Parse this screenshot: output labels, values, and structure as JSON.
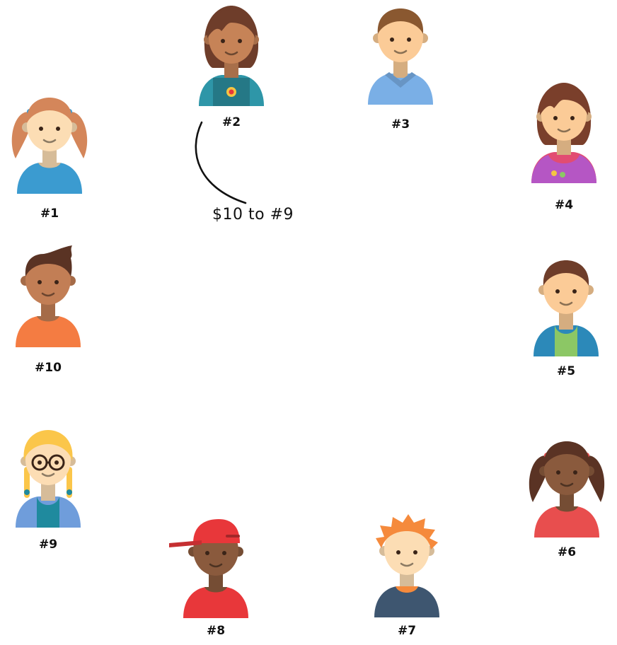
{
  "people": [
    {
      "id": "1",
      "label": "#1",
      "style": "pigtails",
      "skin": "#FCDDB4",
      "hair": "#D4865A",
      "shirt": "#3B9BD0",
      "band": "#3B9BD0"
    },
    {
      "id": "2",
      "label": "#2",
      "style": "bob",
      "skin": "#C68357",
      "hair": "#6E3D2A",
      "shirt": "#2E96A8",
      "band": "#1F7C8C"
    },
    {
      "id": "3",
      "label": "#3",
      "style": "hoodie",
      "skin": "#FBCB97",
      "hair": "#8A5830",
      "shirt": "#7AAFE6",
      "band": "#7AAFE6"
    },
    {
      "id": "4",
      "label": "#4",
      "style": "bangs",
      "skin": "#FBCB97",
      "hair": "#7A3F2B",
      "shirt": "#E24C72",
      "band": "#B556C4"
    },
    {
      "id": "5",
      "label": "#5",
      "style": "boy",
      "skin": "#FBCB97",
      "hair": "#6E3D2A",
      "shirt": "#2C89B9",
      "band": "#8CC765"
    },
    {
      "id": "6",
      "label": "#6",
      "style": "pigtails",
      "skin": "#8A5A3D",
      "hair": "#5A3324",
      "shirt": "#E84E4E",
      "band": "#E84E4E"
    },
    {
      "id": "7",
      "label": "#7",
      "style": "spiky",
      "skin": "#FCDDB4",
      "hair": "#F58A3C",
      "shirt": "#3E5670",
      "band": "#F58A3C"
    },
    {
      "id": "8",
      "label": "#8",
      "style": "cap",
      "skin": "#8A5A3D",
      "hair": "#E8373A",
      "shirt": "#E8373A",
      "band": "#E8373A"
    },
    {
      "id": "9",
      "label": "#9",
      "style": "blonde",
      "skin": "#FCDDB4",
      "hair": "#FBC64A",
      "shirt": "#6F9DDB",
      "band": "#1F8A9E"
    },
    {
      "id": "10",
      "label": "#10",
      "style": "quiff",
      "skin": "#C27E55",
      "hair": "#5A3324",
      "shirt": "#F47C42",
      "band": "#F47C42"
    }
  ],
  "annotation": {
    "text": "$10 to #9"
  }
}
